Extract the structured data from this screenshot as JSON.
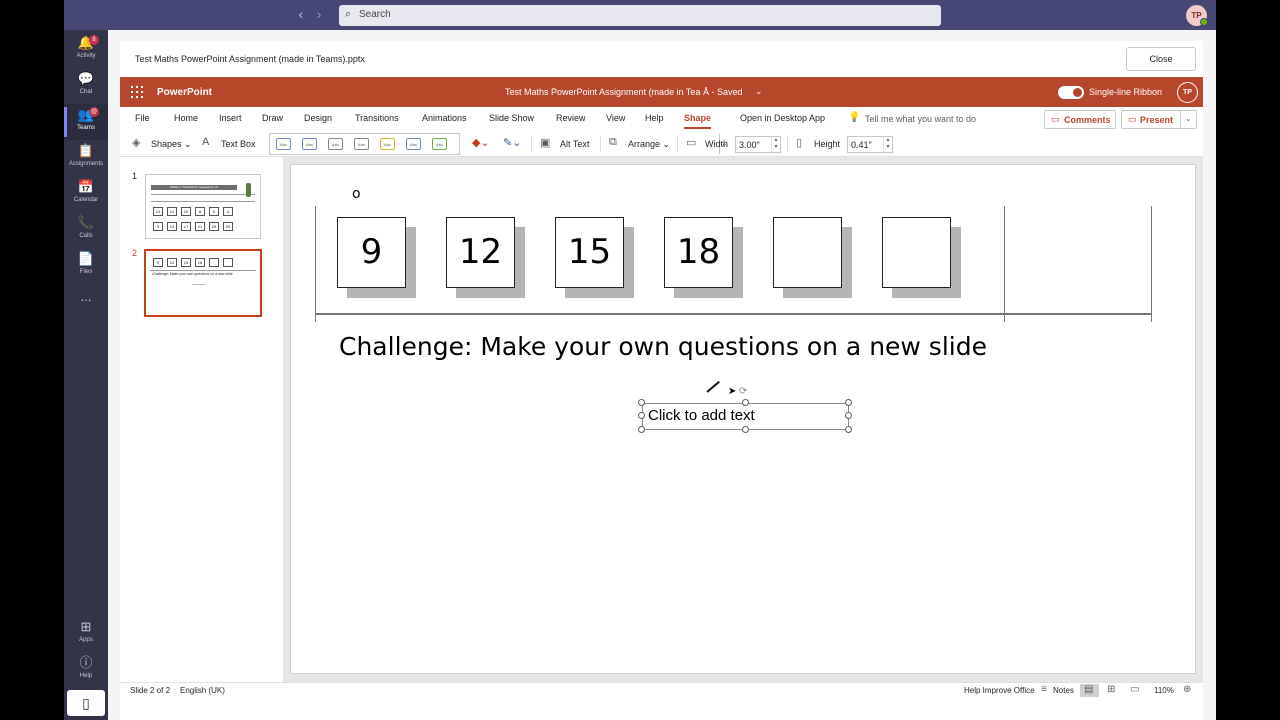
{
  "teams": {
    "search_placeholder": "Search",
    "user_initials": "TP",
    "rail": [
      {
        "label": "Activity",
        "icon": "bell-icon",
        "glyph": "🔔",
        "badge": "8",
        "active": false
      },
      {
        "label": "Chat",
        "icon": "chat-icon",
        "glyph": "💬",
        "active": false
      },
      {
        "label": "Teams",
        "icon": "teams-icon",
        "glyph": "👥",
        "badge": "@",
        "active": true
      },
      {
        "label": "Assignments",
        "icon": "assignments-icon",
        "glyph": "📋",
        "active": false
      },
      {
        "label": "Calendar",
        "icon": "calendar-icon",
        "glyph": "📅",
        "active": false
      },
      {
        "label": "Calls",
        "icon": "phone-icon",
        "glyph": "📞",
        "active": false
      },
      {
        "label": "Files",
        "icon": "file-icon",
        "glyph": "📄",
        "active": false
      }
    ],
    "more_label": "...",
    "apps_label": "Apps",
    "help_label": "Help"
  },
  "file_header": {
    "title": "Test Maths PowerPoint Assignment (made in Teams).pptx",
    "close_label": "Close"
  },
  "ppt_header": {
    "app_name": "PowerPoint",
    "doc_title": "Test Maths PowerPoint Assignment (made in Tea",
    "saved_status": "- Saved",
    "single_line_label": "Single-line Ribbon",
    "user_initials": "TP"
  },
  "ribbon": {
    "tabs": [
      "File",
      "Home",
      "Insert",
      "Draw",
      "Design",
      "Transitions",
      "Animations",
      "Slide Show",
      "Review",
      "View",
      "Help",
      "Shape",
      "Open in Desktop App"
    ],
    "active_tab": "Shape",
    "tell_me": "Tell me what you want to do",
    "comments_label": "Comments",
    "present_label": "Present"
  },
  "toolbar": {
    "shapes_label": "Shapes",
    "textbox_label": "Text Box",
    "style_chip_text": "Abc",
    "alt_text_label": "Alt Text",
    "arrange_label": "Arrange",
    "width_label": "Width",
    "width_value": "3.00\"",
    "height_label": "Height",
    "height_value": "0.41\""
  },
  "thumbnails": {
    "slide1_num": "1",
    "slide2_num": "2",
    "slide1_title": "Addition / Subtraction Sequences (1)",
    "slide1_values_row1": [
      "14",
      "12",
      "10",
      "8",
      "6",
      "4"
    ],
    "slide1_values_row2": [
      "9",
      "13",
      "17",
      "21",
      "25",
      "29"
    ],
    "slide2_values": [
      "9",
      "12",
      "15",
      "18",
      "",
      ""
    ],
    "slide2_challenge": "Challenge: Make your own questions on a new slide"
  },
  "slide": {
    "small_mark": "o",
    "sequence": [
      "9",
      "12",
      "15",
      "18",
      "",
      ""
    ],
    "challenge": "Challenge: Make your own questions on a new slide",
    "textbox_placeholder": "Click to add text"
  },
  "status": {
    "slide_position": "Slide 2 of 2",
    "language": "English (UK)",
    "help_improve": "Help Improve Office",
    "notes_label": "Notes",
    "zoom": "110%"
  },
  "colors": {
    "ppt_red": "#b7472a",
    "teams_purple": "#464775",
    "rail_dark": "#33344a"
  }
}
